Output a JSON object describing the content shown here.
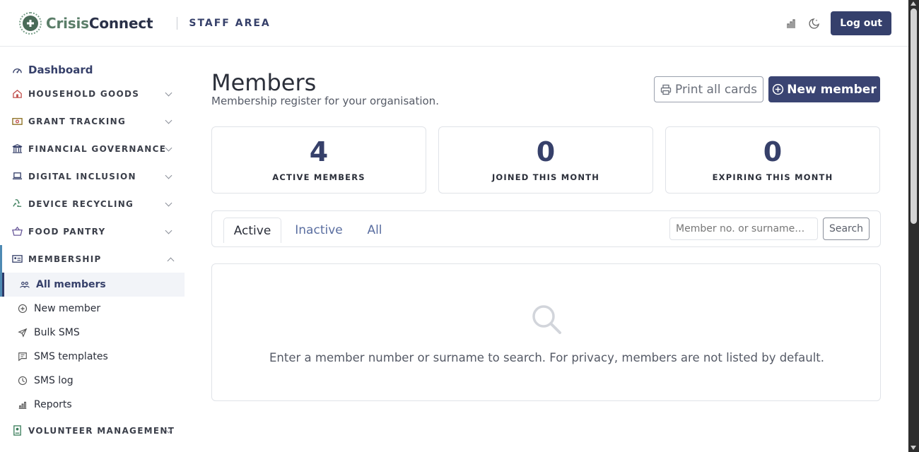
{
  "header": {
    "brand_part1": "Crisis",
    "brand_part2": "Connect",
    "area_label": "STAFF AREA",
    "logout_label": "Log out",
    "icons": [
      "chart-icon",
      "moon-icon"
    ]
  },
  "sidebar": {
    "dashboard_label": "Dashboard",
    "sections": [
      {
        "label": "HOUSEHOLD GOODS",
        "icon": "house-icon"
      },
      {
        "label": "GRANT TRACKING",
        "icon": "cash-icon"
      },
      {
        "label": "FINANCIAL GOVERNANCE",
        "icon": "bank-icon"
      },
      {
        "label": "DIGITAL INCLUSION",
        "icon": "laptop-icon"
      },
      {
        "label": "DEVICE RECYCLING",
        "icon": "recycle-icon"
      },
      {
        "label": "FOOD PANTRY",
        "icon": "basket-icon"
      },
      {
        "label": "MEMBERSHIP",
        "icon": "id-card-icon"
      },
      {
        "label": "VOLUNTEER MANAGEMENT",
        "icon": "badge-icon"
      }
    ],
    "membership_items": [
      {
        "label": "All members",
        "icon": "people-icon",
        "active": true
      },
      {
        "label": "New member",
        "icon": "plus-circle-icon"
      },
      {
        "label": "Bulk SMS",
        "icon": "send-icon"
      },
      {
        "label": "SMS templates",
        "icon": "message-icon"
      },
      {
        "label": "SMS log",
        "icon": "clock-icon"
      },
      {
        "label": "Reports",
        "icon": "bar-chart-icon"
      }
    ]
  },
  "main": {
    "title": "Members",
    "subtitle": "Membership register for your organisation.",
    "print_label": "Print all cards",
    "new_member_label": "New member",
    "stats": [
      {
        "value": "4",
        "label": "ACTIVE MEMBERS"
      },
      {
        "value": "0",
        "label": "JOINED THIS MONTH"
      },
      {
        "value": "0",
        "label": "EXPIRING THIS MONTH"
      }
    ],
    "tabs": [
      "Active",
      "Inactive",
      "All"
    ],
    "search_placeholder": "Member no. or surname…",
    "search_label": "Search",
    "empty_message": "Enter a member number or surname to search. For privacy, members are not listed by default."
  },
  "colors": {
    "primary": "#35406c",
    "accent": "#4e8ab3",
    "brand_green": "#5a7d68"
  }
}
